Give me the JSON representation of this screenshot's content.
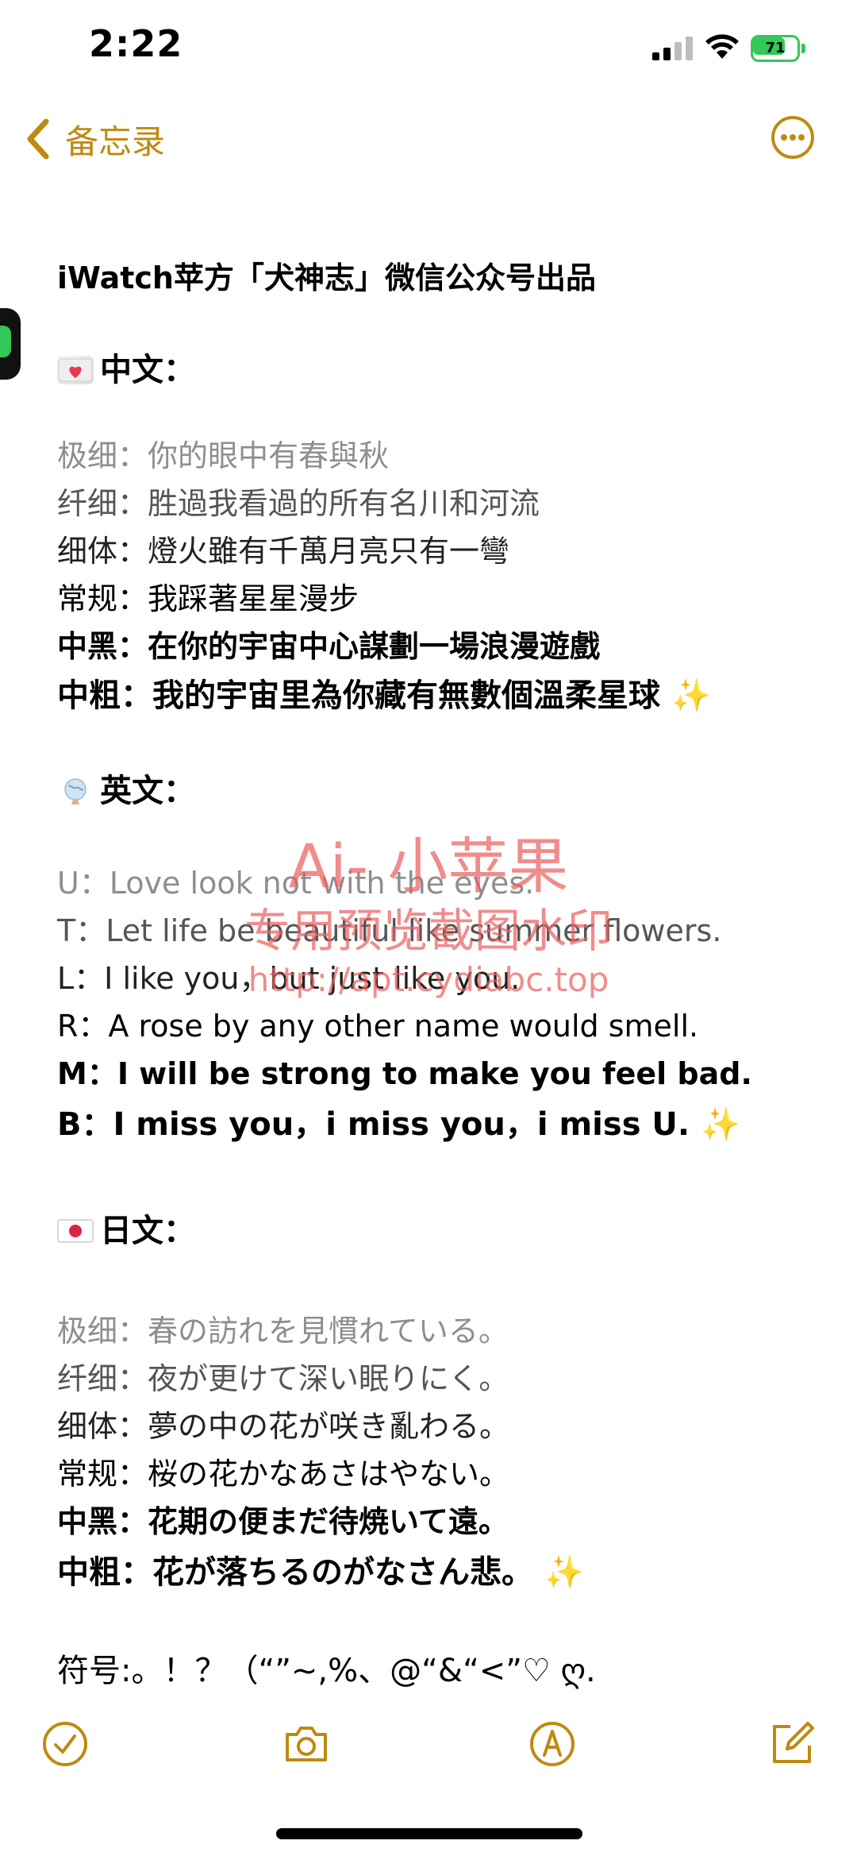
{
  "status_bar": {
    "time": "2:22",
    "battery_level": "71",
    "battery_fraction": 0.71
  },
  "nav": {
    "back_label": "备忘录",
    "accent_color": "#c08a10"
  },
  "note": {
    "title": "iWatch苹方「犬神志」微信公众号出品",
    "sections": {
      "chinese": {
        "heading": "中文：",
        "icon": "heart-letter-emoji",
        "lines": [
          "极细：你的眼中有春與秋",
          "纤细：胜過我看過的所有名川和河流",
          "细体：燈火雖有千萬月亮只有一彎",
          "常规：我踩著星星漫步",
          "中黑：在你的宇宙中心謀劃一場浪漫遊戲",
          "中粗：我的宇宙里為你藏有無數個溫柔星球"
        ]
      },
      "english": {
        "heading": "英文：",
        "icon": "globe-emoji",
        "lines": [
          "U：Love look not with the eyes.",
          "T：Let life be beautiful like summer flowers.",
          "L：I like you，but just like you.",
          "R：A rose by any other name would smell.",
          "M：I will be strong to make you feel bad.",
          "B：I miss you，i miss you，i miss U."
        ]
      },
      "japanese": {
        "heading": "日文：",
        "icon": "japan-flag-emoji",
        "lines": [
          "极细：春の訪れを見慣れている。",
          "纤细：夜が更けて深い眠りにく。",
          "细体：夢の中の花が咲き亂わる。",
          "常规：桜の花かなあさはやない。",
          "中黑：花期の便まだ待焼いて遠。",
          "中粗：花が落ちるのがなさん悲。"
        ]
      }
    },
    "symbols": "符号:。！？（“”~,%、@“&“<”♡ ღ.",
    "sparkle": "✨"
  },
  "watermark": {
    "line1": "Ai- 小苹果",
    "line2": "专用预览截图水印",
    "line3": "http://apt.cydiabc.top"
  }
}
